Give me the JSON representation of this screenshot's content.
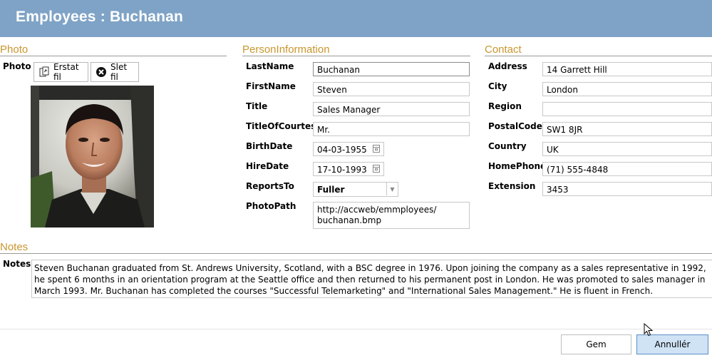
{
  "window": {
    "title": "Employees : Buchanan"
  },
  "groups": {
    "photo": "Photo",
    "person": "PersonInformation",
    "contact": "Contact",
    "notes": "Notes"
  },
  "photo": {
    "label": "Photo",
    "replace_label": "Erstat fil",
    "delete_label": "Slet fil"
  },
  "person": {
    "lastname_label": "LastName",
    "lastname": "Buchanan",
    "firstname_label": "FirstName",
    "firstname": "Steven",
    "title_label": "Title",
    "title": "Sales Manager",
    "courtesy_label": "TitleOfCourtesy",
    "courtesy": "Mr.",
    "birthdate_label": "BirthDate",
    "birthdate": "04-03-1955",
    "hiredate_label": "HireDate",
    "hiredate": "17-10-1993",
    "reportsto_label": "ReportsTo",
    "reportsto": "Fuller",
    "photopath_label": "PhotoPath",
    "photopath": "http://accweb/emmployees/ buchanan.bmp"
  },
  "contact": {
    "address_label": "Address",
    "address": "14 Garrett Hill",
    "city_label": "City",
    "city": "London",
    "region_label": "Region",
    "region": "",
    "postal_label": "PostalCode",
    "postal": "SW1 8JR",
    "country_label": "Country",
    "country": "UK",
    "homephone_label": "HomePhone",
    "homephone": "(71) 555-4848",
    "extension_label": "Extension",
    "extension": "3453"
  },
  "notes": {
    "label": "Notes",
    "text": "Steven Buchanan graduated from St. Andrews University, Scotland, with a BSC degree in 1976.  Upon joining the company as a sales representative in 1992, he spent 6 months in an orientation program at the Seattle office and then returned to his permanent post in London.  He was promoted to sales manager in March 1993.  Mr. Buchanan has completed the courses \"Successful Telemarketing\" and \"International Sales Management.\"  He is fluent in French."
  },
  "footer": {
    "save_label": "Gem",
    "cancel_label": "Annullér"
  },
  "icons": {
    "replace": "file-replace-icon",
    "delete": "delete-circle-icon",
    "calendar": "calendar-icon",
    "dropdown": "chevron-down-icon"
  },
  "colors": {
    "titlebar": "#7fa3c6",
    "group_title": "#c9962e",
    "primary_button": "#cfe3f5"
  }
}
